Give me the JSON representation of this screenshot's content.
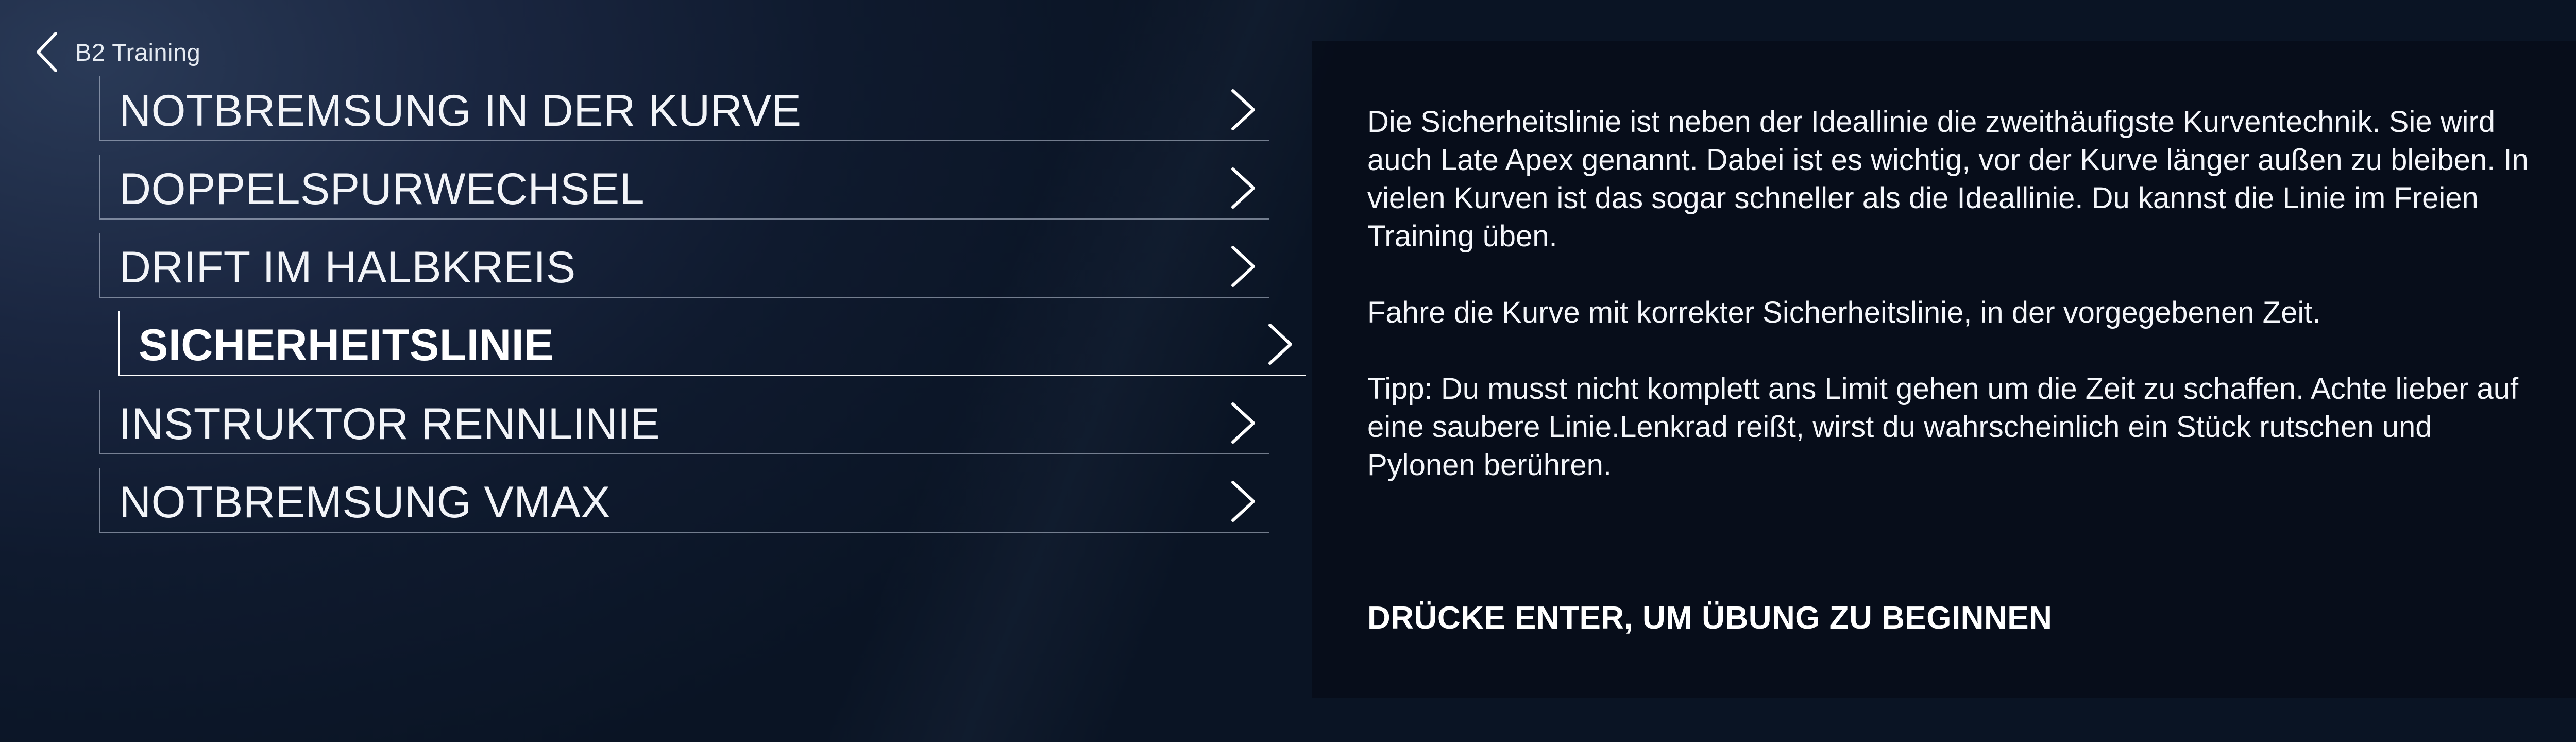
{
  "nav": {
    "back_icon": "chevron-left-icon",
    "title": "B2 Training"
  },
  "menu": {
    "chevron_icon": "chevron-right-icon",
    "items": [
      {
        "label": "NOTBREMSUNG IN DER KURVE"
      },
      {
        "label": "DOPPELSPURWECHSEL"
      },
      {
        "label": "DRIFT IM HALBKREIS"
      },
      {
        "label": "SICHERHEITSLINIE",
        "selected": true
      },
      {
        "label": "INSTRUKTOR RENNLINIE"
      },
      {
        "label": "NOTBREMSUNG VMAX"
      }
    ]
  },
  "detail": {
    "paragraphs": [
      "Die Sicherheitslinie ist neben der Ideallinie die zweithäufigste Kurventechnik. Sie wird auch Late Apex genannt. Dabei ist es wichtig, vor der Kurve länger außen zu bleiben. In vielen Kurven ist das sogar schneller als die Ideallinie. Du kannst die Linie im Freien Training üben.",
      "Fahre die Kurve mit korrekter Sicherheitslinie, in der vorgegebenen Zeit.",
      "Tipp: Du musst nicht komplett ans Limit gehen um die Zeit zu schaffen. Achte lieber auf eine saubere Linie.Lenkrad reißt, wirst du wahrscheinlich ein Stück rutschen und Pylonen berühren."
    ],
    "cta": "DRÜCKE ENTER, UM ÜBUNG ZU BEGINNEN"
  },
  "colors": {
    "background": "#0c1628",
    "panel": "#070d19",
    "text": "#ffffff"
  }
}
